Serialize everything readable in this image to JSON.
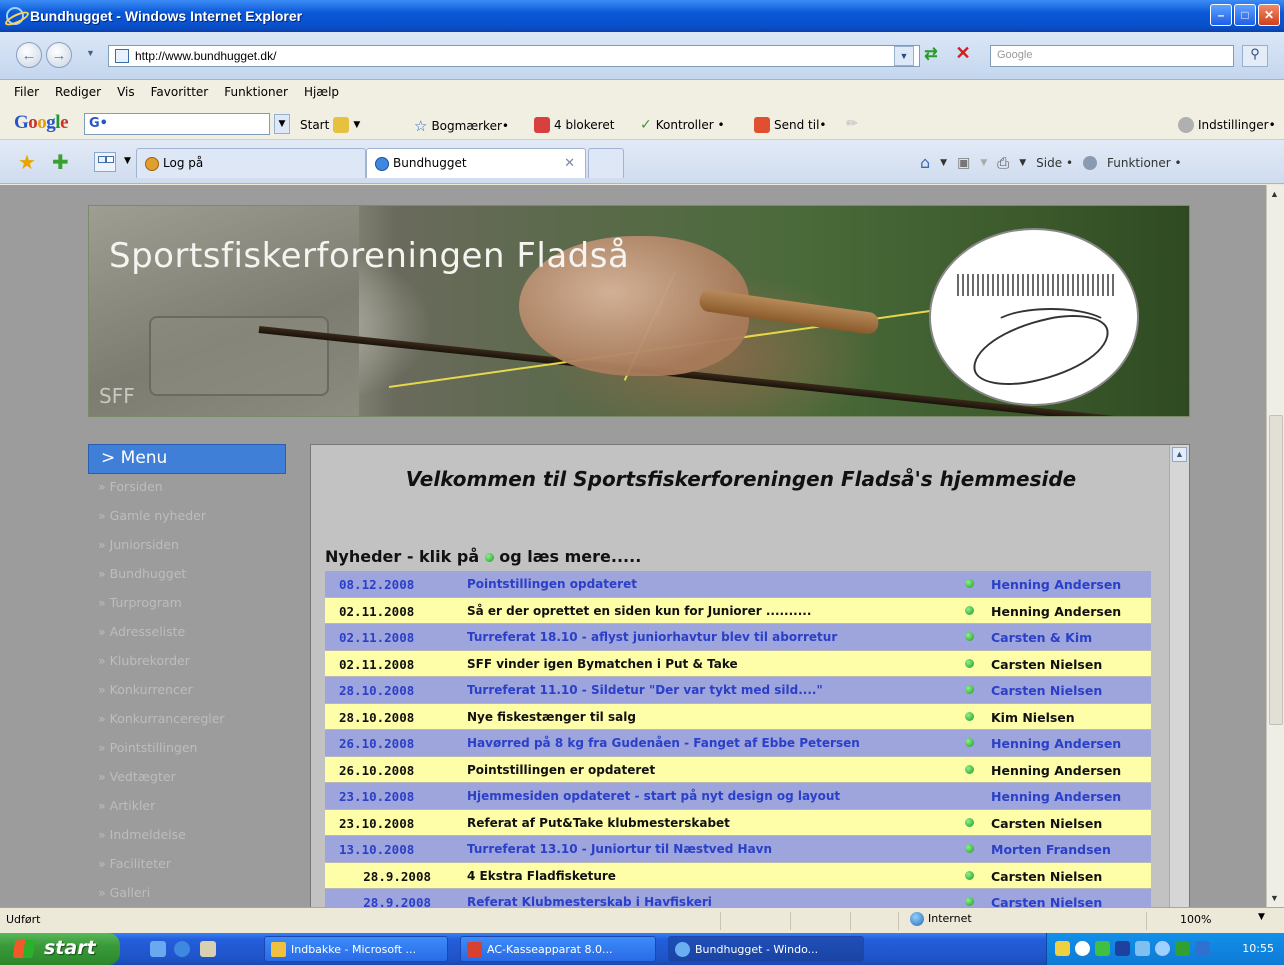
{
  "window": {
    "title": "Bundhugget - Windows Internet Explorer",
    "minimize": "–",
    "maximize": "□",
    "close": "✕"
  },
  "address_bar": {
    "url": "http://www.bundhugget.dk/",
    "search_placeholder": "Google"
  },
  "menu_bar": [
    "Filer",
    "Rediger",
    "Vis",
    "Favoritter",
    "Funktioner",
    "Hjælp"
  ],
  "google_toolbar": {
    "logo": "Google",
    "search_value": "G•",
    "start_label": "Start",
    "bookmarks_label": "Bogmærker•",
    "blocked_label": "4 blokeret",
    "check_label": "Kontroller •",
    "sendto_label": "Send til•",
    "settings_label": "Indstillinger•"
  },
  "tabs": [
    {
      "label": "Log på",
      "active": false
    },
    {
      "label": "Bundhugget",
      "active": true
    }
  ],
  "command_bar": {
    "page_label": "Side •",
    "tools_label": "Funktioner •"
  },
  "site": {
    "title": "Sportsfiskerforeningen Fladså",
    "abbr": "SFF"
  },
  "left_menu": {
    "heading": "> Menu",
    "items": [
      "Forsiden",
      "Gamle nyheder",
      "Juniorsiden",
      "Bundhugget",
      "Turprogram",
      "Adresseliste",
      "Klubrekorder",
      "Konkurrencer",
      "Konkurranceregler",
      "Pointstillingen",
      "Vedtægter",
      "Artikler",
      "Indmeldelse",
      "Faciliteter",
      "Galleri"
    ]
  },
  "main": {
    "welcome": "Velkommen til Sportsfiskerforeningen Fladså's hjemmeside",
    "news_heading_prefix": "Nyheder - klik på",
    "news_heading_suffix": "og læs mere.....",
    "news": [
      {
        "date": "08.12.2008",
        "title": "Pointstillingen opdateret",
        "author": "Henning Andersen",
        "dot": true
      },
      {
        "date": "02.11.2008",
        "title": "Så er der oprettet en siden kun for Juniorer ..........",
        "author": "Henning Andersen",
        "dot": true
      },
      {
        "date": "02.11.2008",
        "title": "Turreferat 18.10 - aflyst juniorhavtur blev til aborretur",
        "author": "Carsten & Kim",
        "dot": true
      },
      {
        "date": "02.11.2008",
        "title": "SFF vinder igen Bymatchen i Put & Take",
        "author": "Carsten Nielsen",
        "dot": true
      },
      {
        "date": "28.10.2008",
        "title": "Turreferat 11.10 - Sildetur \"Der var tykt med sild....\"",
        "author": "Carsten Nielsen",
        "dot": true
      },
      {
        "date": "28.10.2008",
        "title": "Nye fiskestænger til salg",
        "author": "Kim Nielsen",
        "dot": true
      },
      {
        "date": "26.10.2008",
        "title": "Havørred på 8 kg fra Gudenåen - Fanget af Ebbe Petersen",
        "author": "Henning Andersen",
        "dot": true
      },
      {
        "date": "26.10.2008",
        "title": "Pointstillingen er opdateret",
        "author": "Henning Andersen",
        "dot": true
      },
      {
        "date": "23.10.2008",
        "title": "Hjemmesiden opdateret - start på nyt design og layout",
        "author": "Henning Andersen",
        "dot": false
      },
      {
        "date": "23.10.2008",
        "title": "Referat af Put&Take klubmesterskabet",
        "author": "Carsten Nielsen",
        "dot": true
      },
      {
        "date": "13.10.2008",
        "title": "Turreferat 13.10 - Juniortur til Næstved Havn",
        "author": "Morten Frandsen",
        "dot": true
      },
      {
        "date": "28.9.2008",
        "title": "4 Ekstra Fladfisketure",
        "author": "Carsten Nielsen",
        "dot": true
      },
      {
        "date": "28.9.2008",
        "title": "Referat Klubmesterskab i Havfiskeri",
        "author": "Carsten Nielsen",
        "dot": true
      }
    ]
  },
  "status_bar": {
    "status": "Udført",
    "zone": "Internet",
    "zoom": "100%"
  },
  "taskbar": {
    "start": "start",
    "buttons": [
      "Indbakke - Microsoft ...",
      "AC-Kasseapparat 8.0...",
      "Bundhugget - Windo..."
    ],
    "clock": "10:55"
  }
}
